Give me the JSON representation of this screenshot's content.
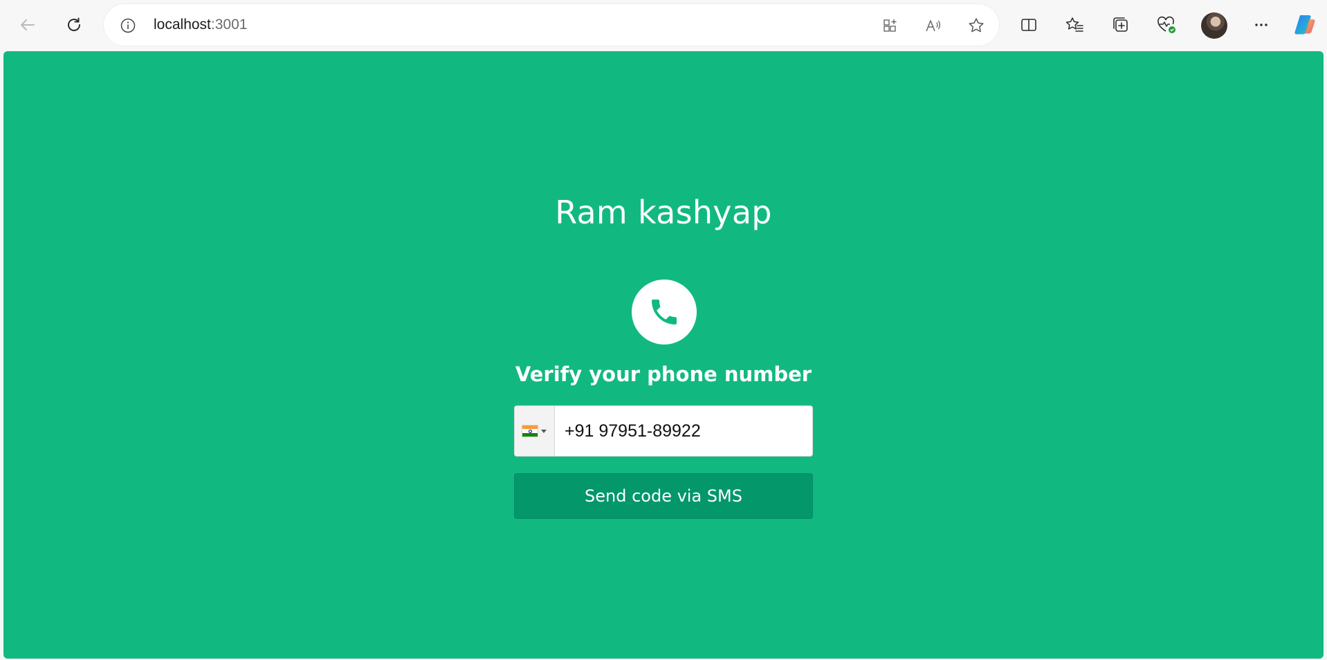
{
  "browser": {
    "url_host": "localhost",
    "url_port": ":3001",
    "icons": {
      "back": "back-arrow-icon",
      "reload": "reload-icon",
      "site_info": "info-icon",
      "app_available": "app-available-icon",
      "read_aloud": "read-aloud-icon",
      "favorite": "star-icon",
      "split_screen": "split-screen-icon",
      "favorites": "favorites-icon",
      "collections": "collections-icon",
      "browser_essentials": "heart-pulse-icon",
      "profile": "avatar",
      "menu": "more-icon",
      "copilot": "copilot-icon"
    }
  },
  "page": {
    "background": "#11b981",
    "title": "Ram kashyap",
    "subtitle": "Verify your phone number",
    "phone_field": {
      "country_flag": "india-flag-icon",
      "value": "+91 97951-89922"
    },
    "send_button_label": "Send code via SMS",
    "button_color": "#03976a"
  }
}
